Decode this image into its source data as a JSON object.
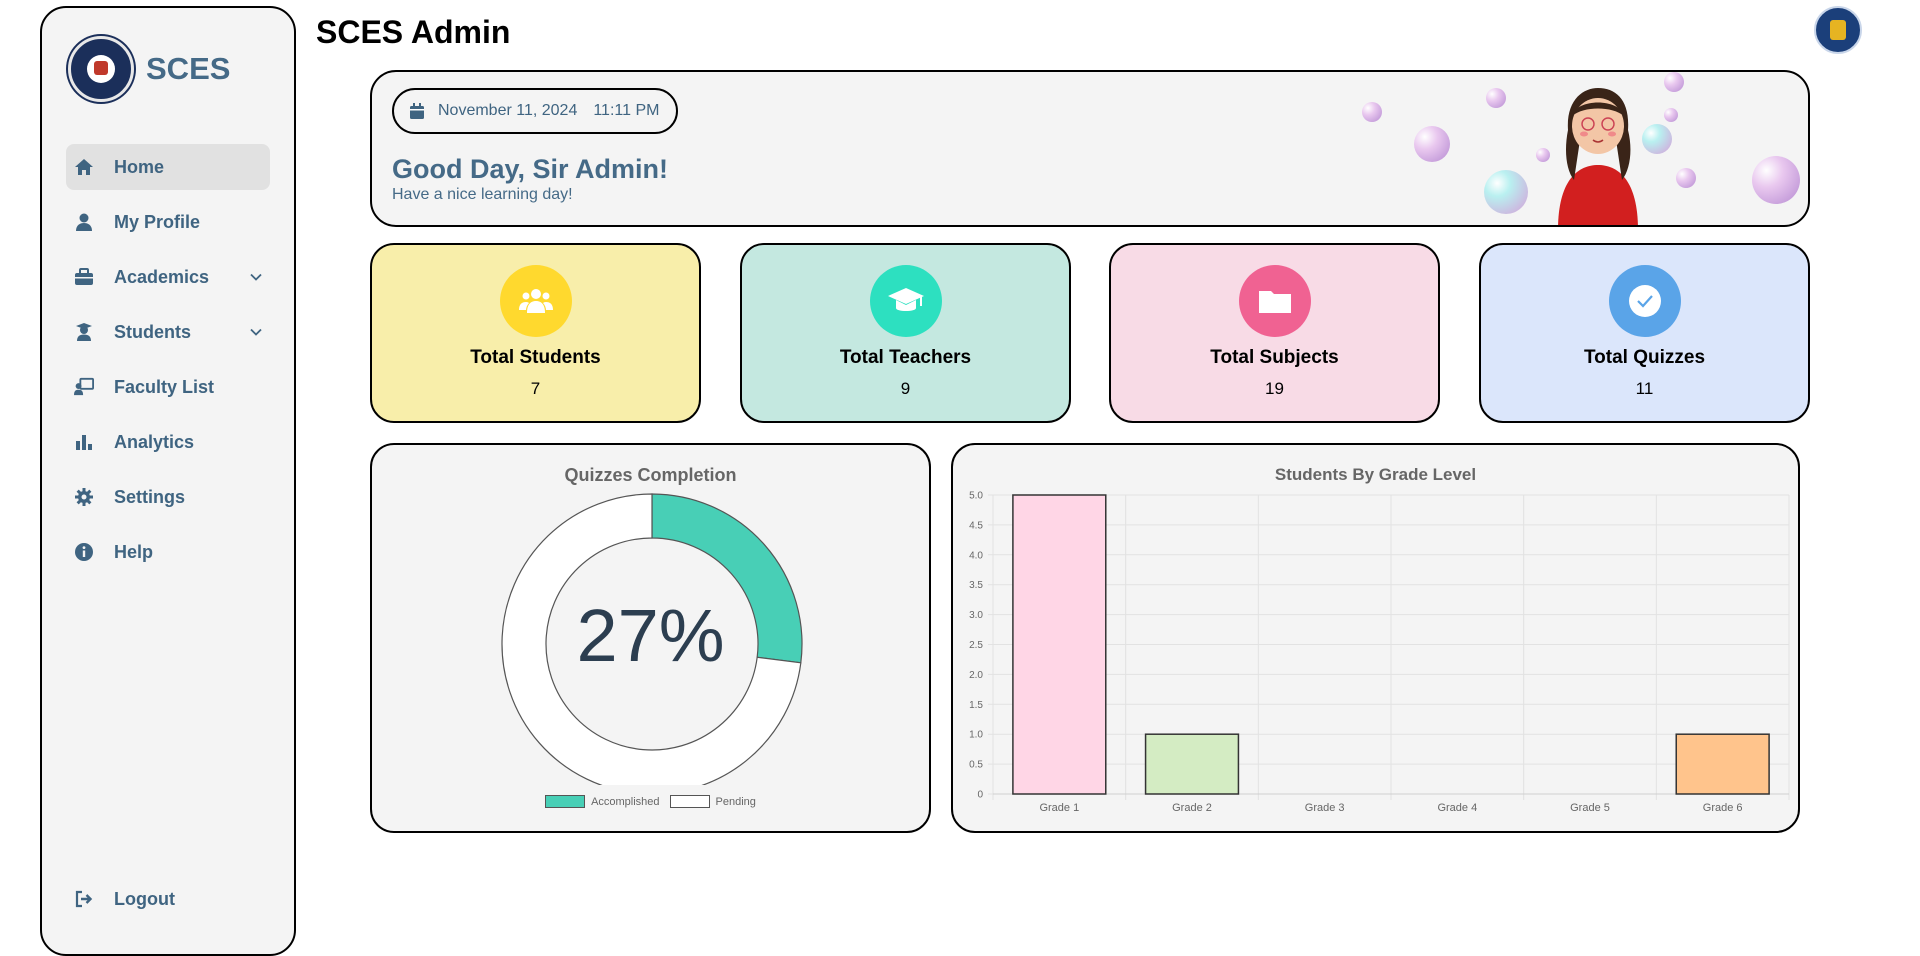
{
  "app": {
    "brand_name": "SCES",
    "page_title": "SCES Admin"
  },
  "sidebar": {
    "items": [
      {
        "label": "Home",
        "icon": "home-icon",
        "active": true
      },
      {
        "label": "My Profile",
        "icon": "user-icon"
      },
      {
        "label": "Academics",
        "icon": "briefcase-icon",
        "has_submenu": true
      },
      {
        "label": "Students",
        "icon": "student-icon",
        "has_submenu": true
      },
      {
        "label": "Faculty List",
        "icon": "teacher-board-icon"
      },
      {
        "label": "Analytics",
        "icon": "bar-chart-icon"
      },
      {
        "label": "Settings",
        "icon": "gear-icon"
      },
      {
        "label": "Help",
        "icon": "info-icon"
      }
    ],
    "logout_label": "Logout"
  },
  "banner": {
    "date": "November 11, 2024",
    "time": "11:11 PM",
    "greeting": "Good Day, Sir Admin!",
    "subtitle": "Have a nice learning day!"
  },
  "stats": [
    {
      "label": "Total Students",
      "value": "7",
      "icon": "users-group-icon",
      "bg": "#f8eeaa",
      "accent": "#ffd92e"
    },
    {
      "label": "Total Teachers",
      "value": "9",
      "icon": "graduation-cap-icon",
      "bg": "#c4e8e0",
      "accent": "#2de0c0"
    },
    {
      "label": "Total Subjects",
      "value": "19",
      "icon": "folder-icon",
      "bg": "#f8dbe6",
      "accent": "#f06292"
    },
    {
      "label": "Total Quizzes",
      "value": "11",
      "icon": "check-circle-icon",
      "bg": "#dbe6fb",
      "accent": "#5aa4e8"
    }
  ],
  "quizzes_chart": {
    "title": "Quizzes Completion",
    "center_text": "27%",
    "legend": [
      {
        "label": "Accomplished",
        "color": "#48cfb6"
      },
      {
        "label": "Pending",
        "color": "#ffffff"
      }
    ]
  },
  "grade_chart": {
    "title": "Students By Grade Level"
  },
  "chart_data": [
    {
      "type": "pie",
      "title": "Quizzes Completion",
      "categories": [
        "Accomplished",
        "Pending"
      ],
      "values": [
        27,
        73
      ],
      "colors": [
        "#48cfb6",
        "#ffffff"
      ],
      "legend": "bottom"
    },
    {
      "type": "bar",
      "title": "Students By Grade Level",
      "categories": [
        "Grade 1",
        "Grade 2",
        "Grade 3",
        "Grade 4",
        "Grade 5",
        "Grade 6"
      ],
      "values": [
        5,
        1,
        0,
        0,
        0,
        1
      ],
      "colors": [
        "#ffd6e6",
        "#d4ecc3",
        "#ffffff",
        "#ffffff",
        "#ffffff",
        "#ffc48c"
      ],
      "ylim": [
        0,
        5
      ],
      "yticks": [
        "0",
        "0.5",
        "1.0",
        "1.5",
        "2.0",
        "2.5",
        "3.0",
        "3.5",
        "4.0",
        "4.5",
        "5.0"
      ],
      "grid": true
    }
  ]
}
